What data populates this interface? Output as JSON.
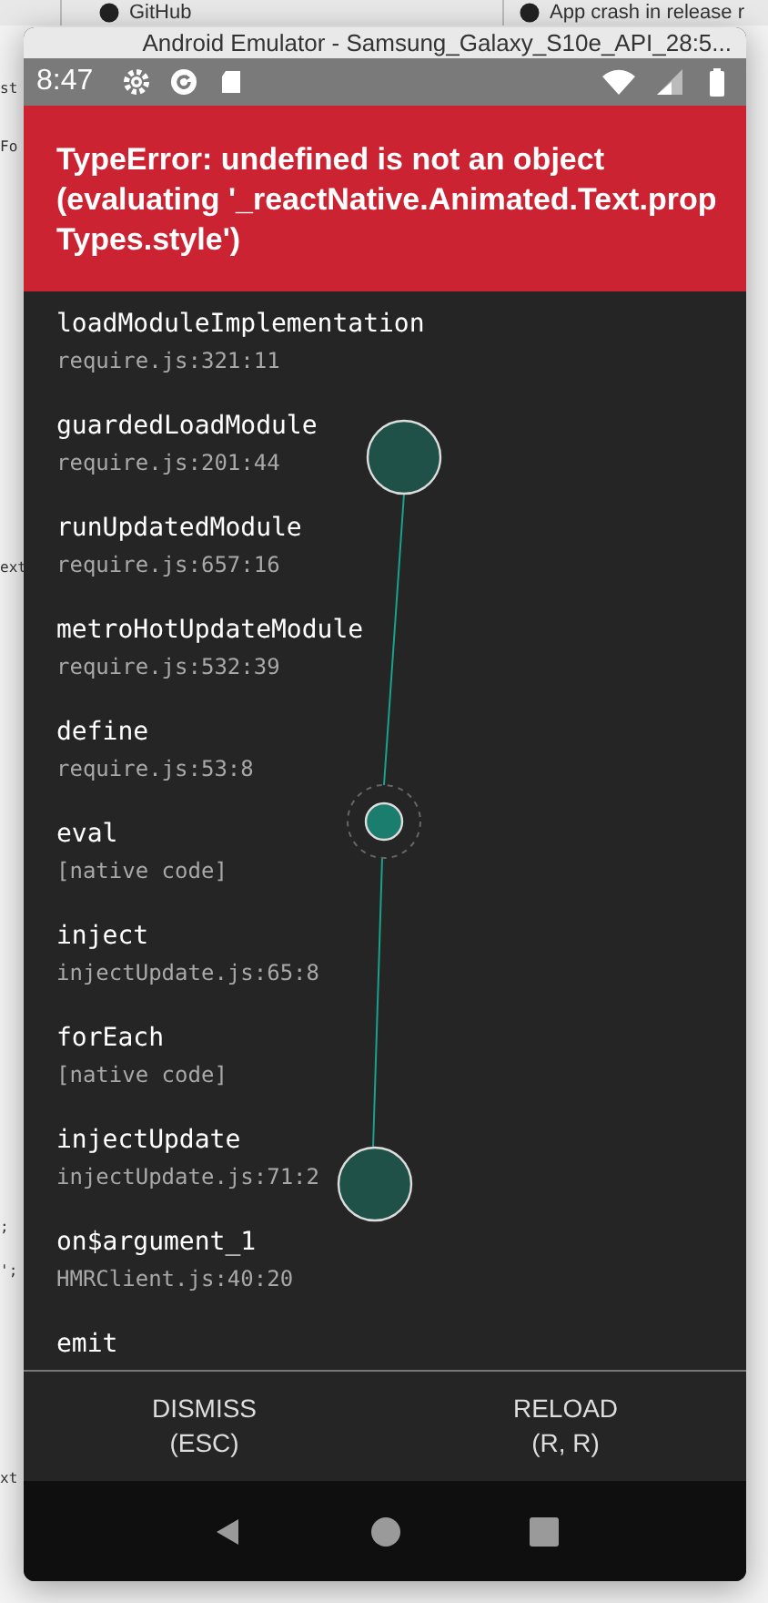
{
  "browser_tabs": [
    {
      "title": "GitHub"
    },
    {
      "title": "App crash in release r"
    }
  ],
  "backdrop_fragments": [
    "st",
    "Fo",
    "ext",
    ";",
    "';",
    "xt"
  ],
  "window": {
    "title": "Android Emulator - Samsung_Galaxy_S10e_API_28:5..."
  },
  "status_bar": {
    "time": "8:47"
  },
  "error": {
    "message": "TypeError: undefined is not an object (evaluating '_reactNative.Animated.Text.prop Types.style')"
  },
  "stack": [
    {
      "method": "loadModuleImplementation",
      "location": "require.js:321:11"
    },
    {
      "method": "guardedLoadModule",
      "location": "require.js:201:44"
    },
    {
      "method": "runUpdatedModule",
      "location": "require.js:657:16"
    },
    {
      "method": "metroHotUpdateModule",
      "location": "require.js:532:39"
    },
    {
      "method": "define",
      "location": "require.js:53:8"
    },
    {
      "method": "eval",
      "location": "[native code]"
    },
    {
      "method": "inject",
      "location": "injectUpdate.js:65:8"
    },
    {
      "method": "forEach",
      "location": "[native code]"
    },
    {
      "method": "injectUpdate",
      "location": "injectUpdate.js:71:2"
    },
    {
      "method": "on$argument_1",
      "location": "HMRClient.js:40:20"
    },
    {
      "method": "emit"
    }
  ],
  "buttons": [
    {
      "label": "DISMISS",
      "shortcut": "(ESC)"
    },
    {
      "label": "RELOAD",
      "shortcut": "(R, R)"
    }
  ]
}
